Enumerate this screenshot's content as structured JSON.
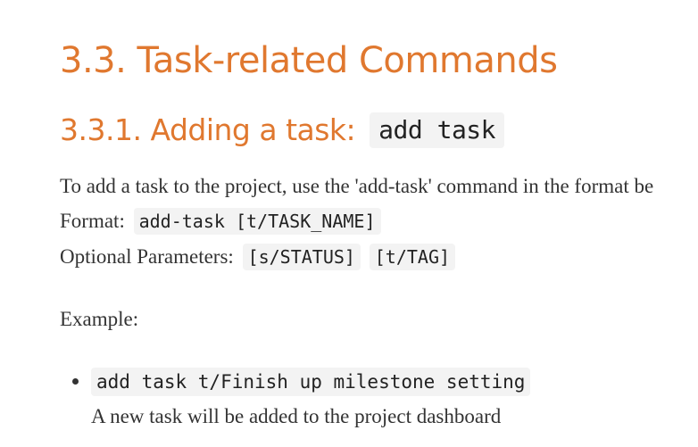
{
  "section": {
    "title": "3.3. Task-related Commands"
  },
  "subsection": {
    "title": "3.3.1. Adding a task:",
    "command": "add task"
  },
  "intro": {
    "text": "To add a task to the project, use the 'add-task' command in the format be"
  },
  "format": {
    "label": "Format:",
    "code": "add-task [t/TASK_NAME]"
  },
  "optional": {
    "label": "Optional Parameters:",
    "params": [
      "[s/STATUS]",
      "[t/TAG]"
    ]
  },
  "example": {
    "label": "Example:",
    "items": [
      {
        "code": "add task t/Finish up milestone setting",
        "description": "A new task will be added to the project dashboard"
      }
    ]
  },
  "colors": {
    "heading": "#e0782f",
    "code_background": "#f3f3f3",
    "body_text": "#333333"
  }
}
